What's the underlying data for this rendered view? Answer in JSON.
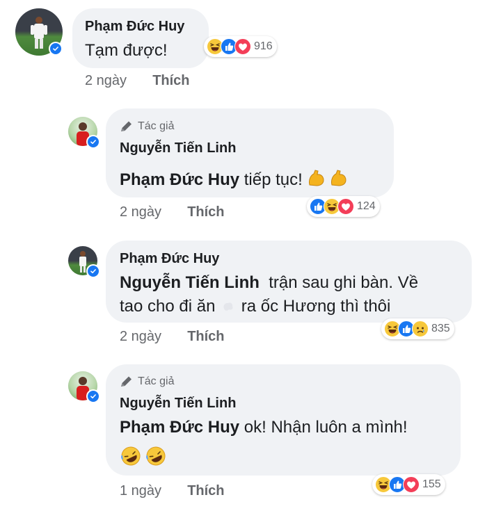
{
  "comments": [
    {
      "author": "Phạm Đức Huy",
      "text": "Tạm được!",
      "time": "2 ngày",
      "like": "Thích",
      "reactions": [
        "haha-icon",
        "like-icon",
        "love-icon"
      ],
      "reaction_count": "916"
    },
    {
      "author_badge": "Tác giả",
      "author": "Nguyễn Tiến Linh",
      "mention": "Phạm Đức Huy",
      "text": " tiếp tục!",
      "time": "2 ngày",
      "like": "Thích",
      "reactions": [
        "like-icon",
        "haha-icon",
        "love-icon"
      ],
      "reaction_count": "124"
    },
    {
      "author": "Phạm Đức Huy",
      "mention": "Nguyễn Tiến Linh",
      "text_line1": "  trận sau ghi bàn. Về",
      "text_line2a": "tao cho đi ăn",
      "text_line2b": " ra ốc Hương thì thôi",
      "time": "2 ngày",
      "like": "Thích",
      "reactions": [
        "haha-icon",
        "like-icon",
        "sad-icon"
      ],
      "reaction_count": "835"
    },
    {
      "author_badge": "Tác giả",
      "author": "Nguyễn Tiến Linh",
      "mention": "Phạm Đức Huy",
      "text": " ok! Nhận luôn a mình!",
      "time": "1 ngày",
      "like": "Thích",
      "reactions": [
        "haha-icon",
        "like-icon",
        "love-icon"
      ],
      "reaction_count": "155"
    }
  ],
  "colors": {
    "bubble": "#f0f2f5",
    "meta": "#65676b",
    "like_blue": "#1877f2",
    "love_red": "#f33e58",
    "haha_yellow": "#f7c83b"
  }
}
